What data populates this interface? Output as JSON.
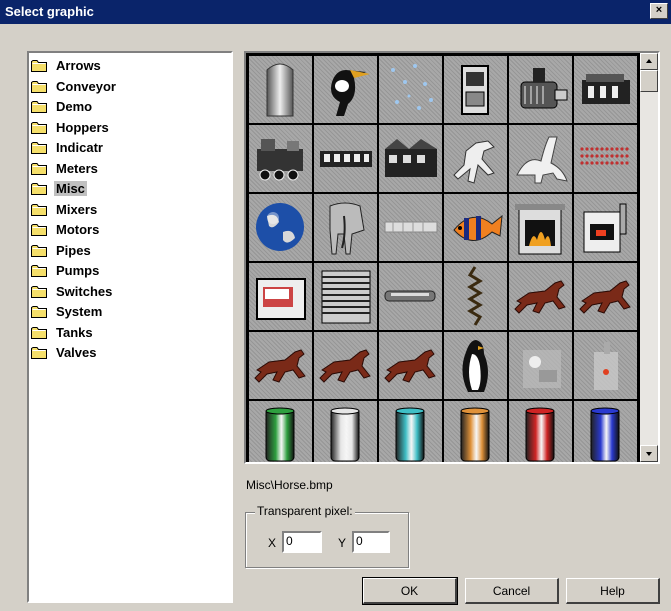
{
  "window": {
    "title": "Select graphic",
    "close_glyph": "×"
  },
  "tree": {
    "items": [
      {
        "label": "Arrows",
        "selected": false
      },
      {
        "label": "Conveyor",
        "selected": false
      },
      {
        "label": "Demo",
        "selected": false
      },
      {
        "label": "Hoppers",
        "selected": false
      },
      {
        "label": "Indicatr",
        "selected": false
      },
      {
        "label": "Meters",
        "selected": false
      },
      {
        "label": "Misc",
        "selected": true
      },
      {
        "label": "Mixers",
        "selected": false
      },
      {
        "label": "Motors",
        "selected": false
      },
      {
        "label": "Pipes",
        "selected": false
      },
      {
        "label": "Pumps",
        "selected": false
      },
      {
        "label": "Switches",
        "selected": false
      },
      {
        "label": "System",
        "selected": false
      },
      {
        "label": "Tanks",
        "selected": false
      },
      {
        "label": "Valves",
        "selected": false
      }
    ]
  },
  "graphics": [
    [
      "silo",
      "toucan",
      "sparkles",
      "machine-box",
      "motor",
      "engine"
    ],
    [
      "locomotive",
      "train-car",
      "factory",
      "t-rex",
      "dinosaur",
      "red-dots"
    ],
    [
      "globe",
      "elephant",
      "pipe-bar",
      "fish",
      "fireplace",
      "stove"
    ],
    [
      "control-panel",
      "grille",
      "pipe-cylinder",
      "spring",
      "horse",
      "horse"
    ],
    [
      "horse",
      "horse",
      "horse",
      "penguin",
      "machine-faded",
      "pump-faded"
    ],
    [
      "cylinder-green",
      "cylinder-white",
      "cylinder-cyan",
      "cylinder-orange",
      "cylinder-red",
      "cylinder-blue"
    ]
  ],
  "cylinder_colors": {
    "green": "#2fa040",
    "white": "#e6e6e6",
    "cyan": "#3fbfc6",
    "orange": "#e0923a",
    "red": "#d02424",
    "blue": "#2a3ad0"
  },
  "selected_file": "Misc\\Horse.bmp",
  "transparent_pixel": {
    "legend": "Transparent pixel:",
    "x_label": "X",
    "x_value": "0",
    "y_label": "Y",
    "y_value": "0"
  },
  "buttons": {
    "ok": "OK",
    "cancel": "Cancel",
    "help": "Help"
  },
  "scrollbar": {
    "up_icon": "triangle-up",
    "down_icon": "triangle-down"
  }
}
